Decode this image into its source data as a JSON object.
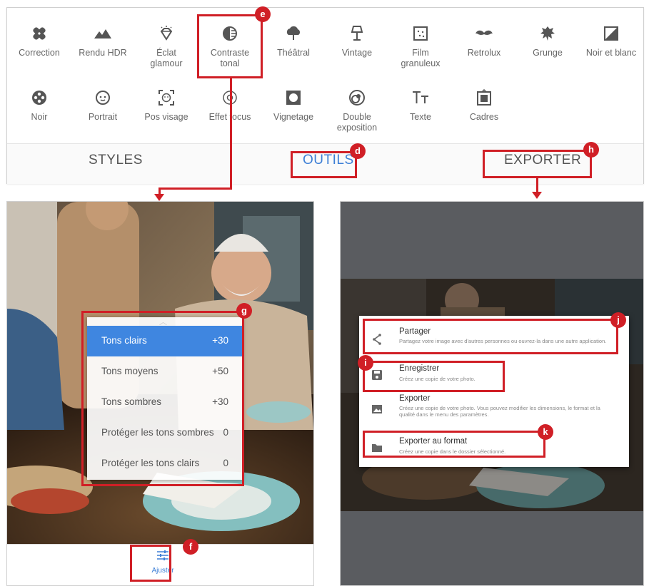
{
  "tools": {
    "row1": [
      {
        "label": "Correction",
        "icon": "healing-icon"
      },
      {
        "label": "Rendu HDR",
        "icon": "mountains-icon"
      },
      {
        "label": "Éclat\nglamour",
        "icon": "diamond-icon"
      },
      {
        "label": "Contraste\ntonal",
        "icon": "tonal-contrast-icon"
      },
      {
        "label": "Théâtral",
        "icon": "cloud-icon"
      },
      {
        "label": "Vintage",
        "icon": "lamp-icon"
      },
      {
        "label": "Film\ngranuleux",
        "icon": "film-grain-icon"
      },
      {
        "label": "Retrolux",
        "icon": "mustache-icon"
      },
      {
        "label": "Grunge",
        "icon": "grunge-icon"
      },
      {
        "label": "Noir et blanc",
        "icon": "black-white-icon"
      }
    ],
    "row2": [
      {
        "label": "Noir",
        "icon": "film-reel-icon"
      },
      {
        "label": "Portrait",
        "icon": "face-icon"
      },
      {
        "label": "Pos visage",
        "icon": "face-pose-icon"
      },
      {
        "label": "Effet focus",
        "icon": "focus-icon"
      },
      {
        "label": "Vignetage",
        "icon": "vignette-icon"
      },
      {
        "label": "Double\nexposition",
        "icon": "double-exposure-icon"
      },
      {
        "label": "Texte",
        "icon": "text-icon"
      },
      {
        "label": "Cadres",
        "icon": "frames-icon"
      }
    ]
  },
  "tabs": {
    "styles": "STYLES",
    "outils": "OUTILS",
    "exporter": "EXPORTER"
  },
  "badges": {
    "d": "d",
    "e": "e",
    "f": "f",
    "g": "g",
    "h": "h",
    "j": "j",
    "i": "i",
    "k": "k"
  },
  "adjust_menu": [
    {
      "name": "Tons clairs",
      "value": "+30",
      "selected": true
    },
    {
      "name": "Tons moyens",
      "value": "+50"
    },
    {
      "name": "Tons sombres",
      "value": "+30"
    },
    {
      "name": "Protéger les tons sombres",
      "value": "0"
    },
    {
      "name": "Protéger les tons clairs",
      "value": "0"
    }
  ],
  "left_toolbar": {
    "adjust_label": "Ajuster"
  },
  "export_dialog": [
    {
      "title": "Partager",
      "desc": "Partagez votre image avec d'autres personnes ou ouvrez-la dans une autre application.",
      "icon": "share-icon"
    },
    {
      "title": "Enregistrer",
      "desc": "Créez une copie de votre photo.",
      "icon": "save-icon"
    },
    {
      "title": "Exporter",
      "desc": "Créez une copie de votre photo. Vous pouvez modifier les dimensions, le format et la qualité dans le menu des paramètres.",
      "icon": "export-image-icon"
    },
    {
      "title": "Exporter au format",
      "desc": "Créez une copie dans le dossier sélectionné.",
      "icon": "folder-icon"
    }
  ],
  "colors": {
    "accent_red": "#d01f26",
    "tab_active": "#3d7fd6",
    "menu_selected": "#3f86e0"
  }
}
